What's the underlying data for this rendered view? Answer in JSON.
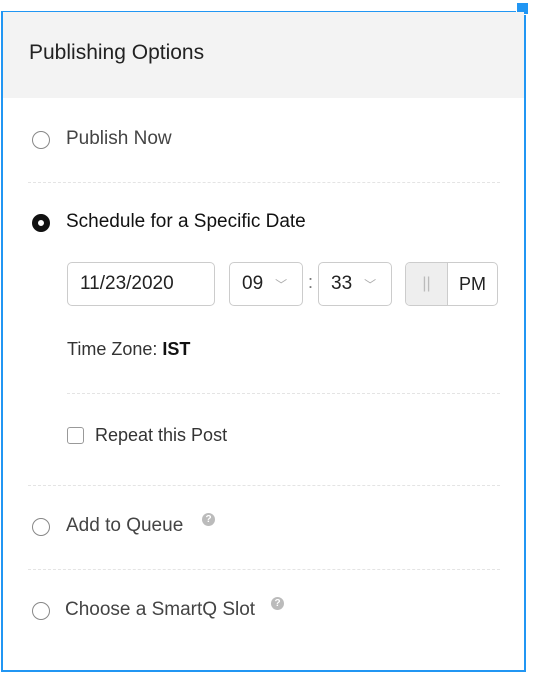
{
  "title": "Publishing Options",
  "options": {
    "publish_now": "Publish Now",
    "schedule": "Schedule for a Specific Date",
    "queue": "Add to Queue",
    "smartq": "Choose a SmartQ Slot"
  },
  "schedule": {
    "date": "11/23/2020",
    "hour": "09",
    "separator": ":",
    "minute": "33",
    "meridiem": "PM",
    "toggle_glyph": "||",
    "timezone_label": "Time Zone:",
    "timezone": "IST",
    "repeat_label": "Repeat this Post"
  },
  "help_glyph": "?",
  "selected": "schedule",
  "colors": {
    "accent": "#2196f3",
    "header_bg": "#f3f3f3"
  }
}
